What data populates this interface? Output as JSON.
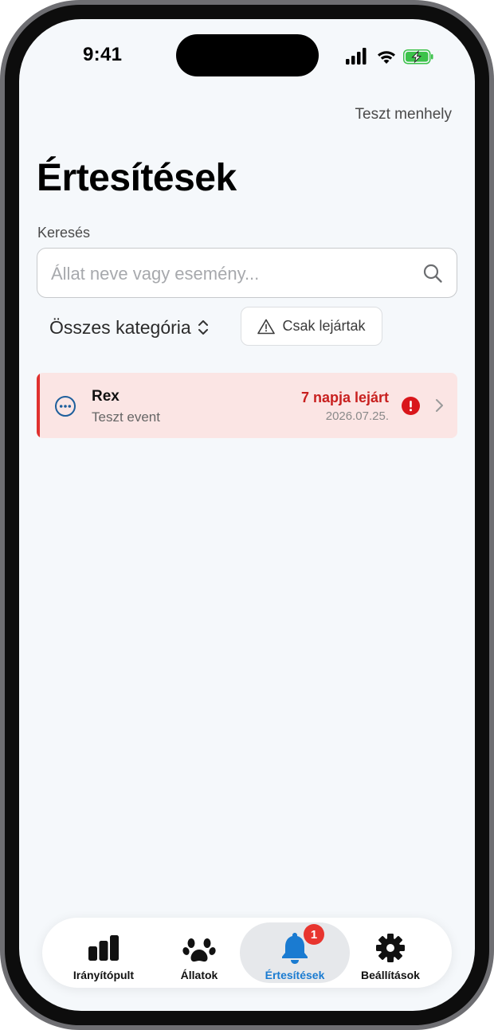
{
  "status_bar": {
    "time": "9:41"
  },
  "header": {
    "shelter_name": "Teszt menhely",
    "title": "Értesítések"
  },
  "search": {
    "label": "Keresés",
    "placeholder": "Állat neve vagy esemény..."
  },
  "filters": {
    "category_value": "Összes kategória",
    "expired_only_label": "Csak lejártak"
  },
  "notifications": [
    {
      "animal": "Rex",
      "event": "Teszt event",
      "status": "7 napja lejárt",
      "date": "2026.07.25.",
      "icon": "more-circle-icon",
      "accent_color": "#e0312f"
    }
  ],
  "tab_bar": {
    "tabs": [
      {
        "label": "Irányítópult",
        "icon": "chart-bars-icon",
        "active": false
      },
      {
        "label": "Állatok",
        "icon": "paw-icon",
        "active": false
      },
      {
        "label": "Értesítések",
        "icon": "bell-icon",
        "active": true,
        "badge": "1"
      },
      {
        "label": "Beállítások",
        "icon": "gear-icon",
        "active": false
      }
    ]
  },
  "colors": {
    "accent": "#1a7bd1",
    "danger": "#c8201f",
    "card_background": "#fbe5e4",
    "screen_background": "#f5f8fb"
  }
}
